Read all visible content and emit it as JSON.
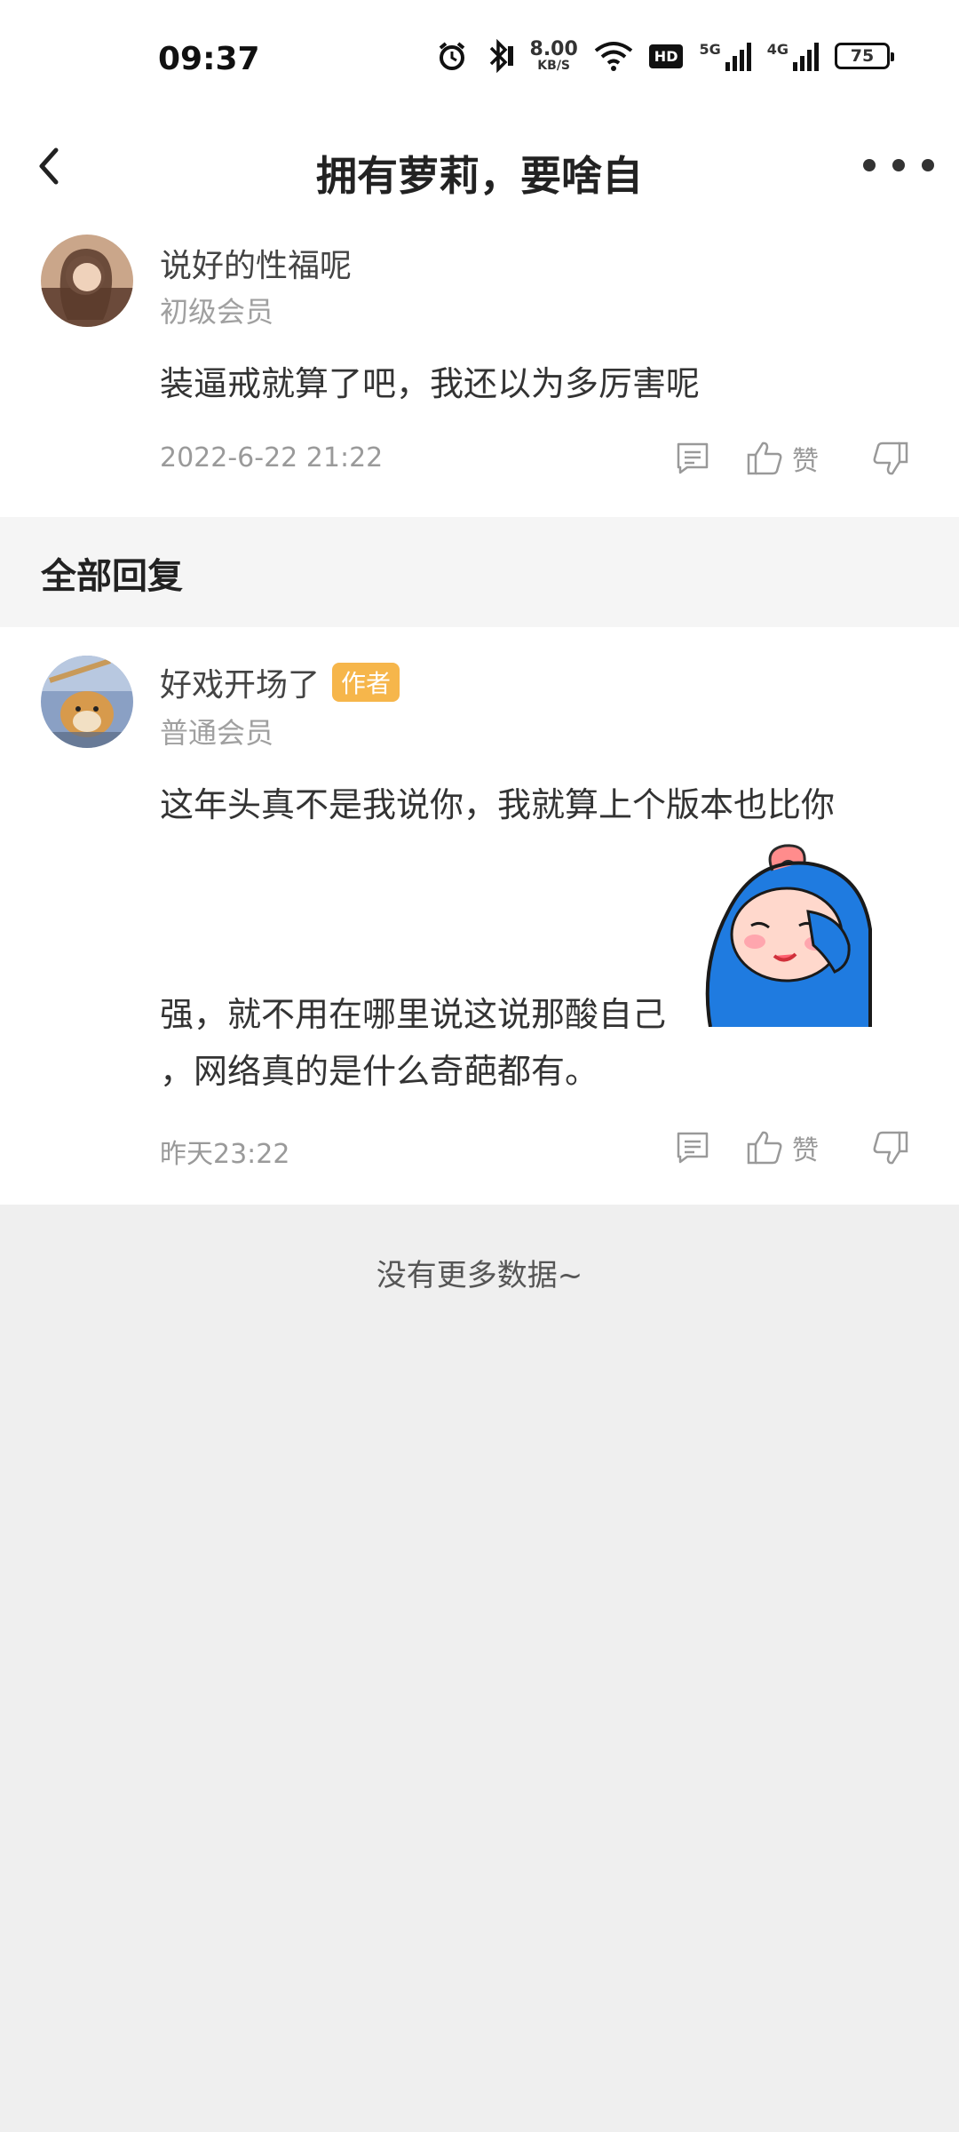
{
  "status_bar": {
    "time": "09:37",
    "net_speed_value": "8.00",
    "net_speed_unit": "KB/S",
    "hd_badge": "HD",
    "signal_1_label": "5G",
    "signal_2_label": "4G",
    "battery": "75"
  },
  "header": {
    "title": "拥有萝莉，要啥自"
  },
  "main_comment": {
    "username": "说好的性福呢",
    "level": "初级会员",
    "text": "装逼戒就算了吧，我还以为多厉害呢",
    "timestamp": "2022-6-22 21:22",
    "like_label": "赞"
  },
  "reply_section": {
    "title": "全部回复"
  },
  "reply": {
    "username": "好戏开场了",
    "author_badge": "作者",
    "level": "普通会员",
    "text_line1": "这年头真不是我说你，我就算上个版本也比你",
    "text_line2": "强，就不用在哪里说这说那酸自己",
    "text_line3": "，网络真的是什么奇葩都有。",
    "timestamp": "昨天23:22",
    "like_label": "赞"
  },
  "footer": {
    "no_more": "没有更多数据~"
  },
  "colors": {
    "background": "#efefef",
    "author_badge": "#f6b64b",
    "sticker_blue": "#1f7be0"
  },
  "icons": [
    "alarm-icon",
    "bluetooth-icon",
    "wifi-icon",
    "back-arrow-icon",
    "more-icon",
    "comment-icon",
    "thumbs-up-icon",
    "thumbs-down-icon"
  ]
}
